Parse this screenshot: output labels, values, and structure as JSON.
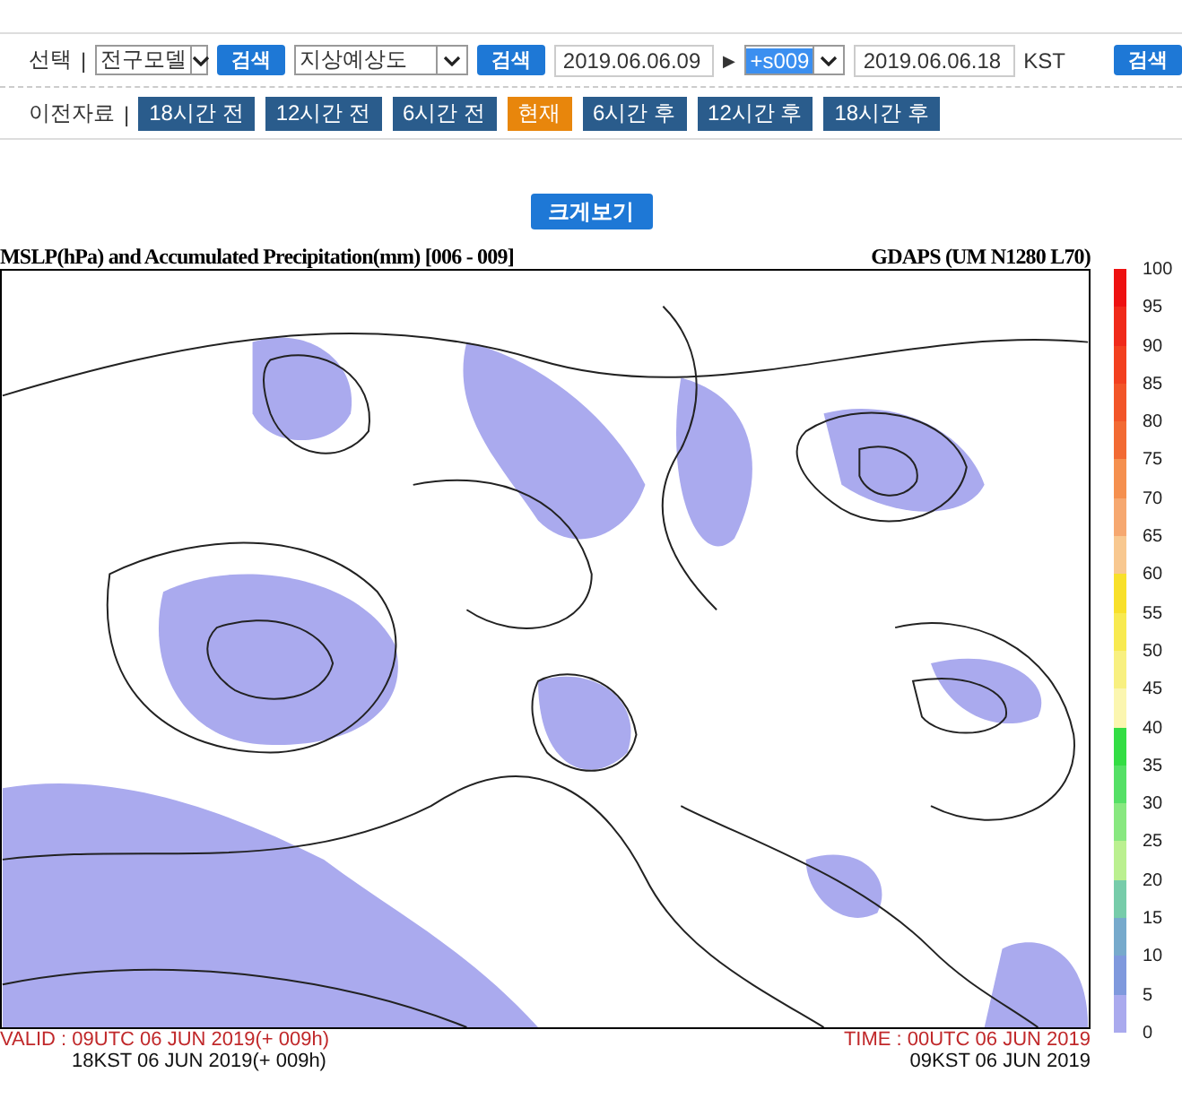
{
  "search_row": {
    "label": "선택",
    "separator": "|",
    "controls": [
      {
        "kind": "select",
        "value": "전구모델",
        "highlighted": false
      },
      {
        "kind": "button",
        "label": "검색"
      },
      {
        "kind": "select",
        "value": "지상예상도",
        "highlighted": false
      },
      {
        "kind": "button",
        "label": "검색"
      },
      {
        "kind": "date",
        "value": "2019.06.06.09"
      },
      {
        "kind": "arrow",
        "label": "▶"
      },
      {
        "kind": "select",
        "value": "+s009",
        "highlighted": true
      },
      {
        "kind": "date",
        "value": "2019.06.06.18"
      },
      {
        "kind": "text",
        "label": "KST"
      },
      {
        "kind": "button",
        "label": "검색"
      }
    ]
  },
  "history_row": {
    "label": "이전자료",
    "separator": "|",
    "buttons": [
      {
        "label": "18시간 전",
        "selected": false
      },
      {
        "label": "12시간 전",
        "selected": false
      },
      {
        "label": "6시간 전",
        "selected": false
      },
      {
        "label": "현재",
        "selected": true
      },
      {
        "label": "6시간 후",
        "selected": false
      },
      {
        "label": "12시간 후",
        "selected": false
      },
      {
        "label": "18시간 후",
        "selected": false
      }
    ]
  },
  "enlarge_button": "크게보기",
  "chart": {
    "title": "MSLP(hPa) and  Accumulated Precipitation(mm) [006 - 009]",
    "model": "GDAPS (UM N1280 L70)",
    "valid_utc": "VALID : 09UTC 06 JUN 2019(+ 009h)",
    "valid_kst": "18KST 06 JUN 2019(+ 009h)",
    "time_utc": "TIME : 00UTC 06 JUN 2019",
    "time_kst": "09KST 06 JUN 2019"
  },
  "legend": {
    "levels": [
      "100",
      "95",
      "90",
      "85",
      "80",
      "75",
      "70",
      "65",
      "60",
      "55",
      "50",
      "45",
      "40",
      "35",
      "30",
      "25",
      "20",
      "15",
      "10",
      "5",
      "0"
    ],
    "bands": [
      {
        "color": "#ee1111"
      },
      {
        "color": "#f02a1a"
      },
      {
        "color": "#f2401f"
      },
      {
        "color": "#f25528"
      },
      {
        "color": "#f26a33"
      },
      {
        "color": "#f5904f"
      },
      {
        "color": "#f6a870"
      },
      {
        "color": "#f8c890"
      },
      {
        "color": "#f8e02a"
      },
      {
        "color": "#f8ea50"
      },
      {
        "color": "#f8f080"
      },
      {
        "color": "#fbf6b0"
      },
      {
        "color": "#33dd44"
      },
      {
        "color": "#55e066"
      },
      {
        "color": "#88e880"
      },
      {
        "color": "#bbf090"
      },
      {
        "color": "#77ccaa"
      },
      {
        "color": "#77aacc"
      },
      {
        "color": "#7f99dd"
      },
      {
        "color": "#aaaaee"
      }
    ]
  }
}
